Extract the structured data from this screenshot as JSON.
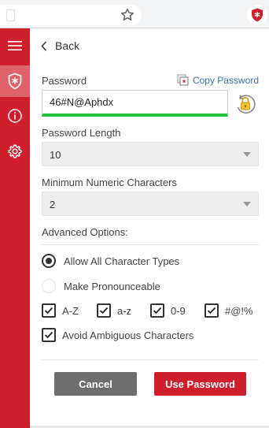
{
  "colors": {
    "brand_red": "#cf1f2d",
    "active_sidebar": "#e0636b",
    "strength_bar": "#22c33a",
    "link_blue": "#3b73b9",
    "cancel_gray": "#6e6e6e"
  },
  "browser": {
    "icons": [
      "star-icon",
      "extension-shield-icon"
    ]
  },
  "sidebar": {
    "items": [
      {
        "icon": "hamburger-menu-icon"
      },
      {
        "icon": "shield-asterisk-icon",
        "active": true
      },
      {
        "icon": "info-icon"
      },
      {
        "icon": "gear-icon"
      }
    ]
  },
  "header": {
    "back_label": "Back"
  },
  "password": {
    "label": "Password",
    "copy_label": "Copy Password",
    "value": "46#N@Aphdx",
    "regenerate_icon": "regenerate-lock-icon"
  },
  "length": {
    "label": "Password Length",
    "selected": "10"
  },
  "numeric": {
    "label": "Minimum Numeric Characters",
    "selected": "2"
  },
  "advanced": {
    "label": "Advanced Options:",
    "radio_all": {
      "label": "Allow All Character Types",
      "checked": true
    },
    "radio_pronounce": {
      "label": "Make Pronounceable",
      "checked": false
    },
    "checks": [
      {
        "label": "A-Z",
        "checked": true
      },
      {
        "label": "a-z",
        "checked": true
      },
      {
        "label": "0-9",
        "checked": true
      },
      {
        "label": "#@!%",
        "checked": true
      }
    ],
    "avoid_ambiguous": {
      "label": "Avoid Ambiguous Characters",
      "checked": true
    }
  },
  "actions": {
    "cancel_label": "Cancel",
    "use_label": "Use Password"
  }
}
